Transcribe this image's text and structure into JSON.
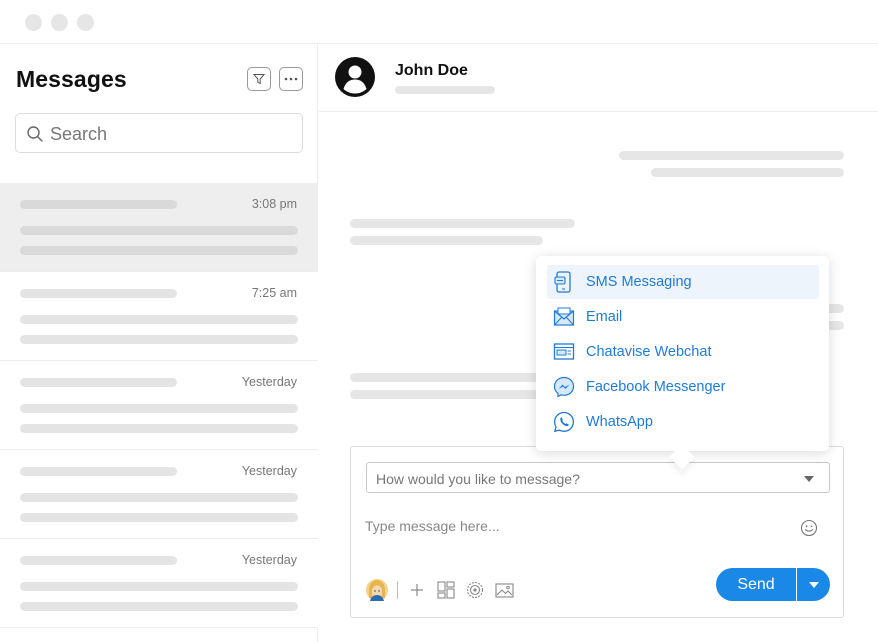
{
  "sidebar": {
    "title": "Messages",
    "search_placeholder": "Search",
    "conversations": [
      {
        "time": "3:08 pm",
        "active": true
      },
      {
        "time": "7:25 am",
        "active": false
      },
      {
        "time": "Yesterday",
        "active": false
      },
      {
        "time": "Yesterday",
        "active": false
      },
      {
        "time": "Yesterday",
        "active": false
      }
    ]
  },
  "header": {
    "contact_name": "John Doe"
  },
  "channel_menu": {
    "options": [
      {
        "label": "SMS Messaging",
        "icon": "sms-icon",
        "highlighted": true
      },
      {
        "label": "Email",
        "icon": "email-icon",
        "highlighted": false
      },
      {
        "label": "Chatavise Webchat",
        "icon": "webchat-icon",
        "highlighted": false
      },
      {
        "label": "Facebook Messenger",
        "icon": "messenger-icon",
        "highlighted": false
      },
      {
        "label": "WhatsApp",
        "icon": "whatsapp-icon",
        "highlighted": false
      }
    ]
  },
  "composer": {
    "channel_placeholder": "How would you like to message?",
    "message_placeholder": "Type message here...",
    "send_label": "Send"
  },
  "colors": {
    "accent": "#1a88e6",
    "link": "#1f7bd8",
    "skeleton": "#e4e4e4"
  }
}
